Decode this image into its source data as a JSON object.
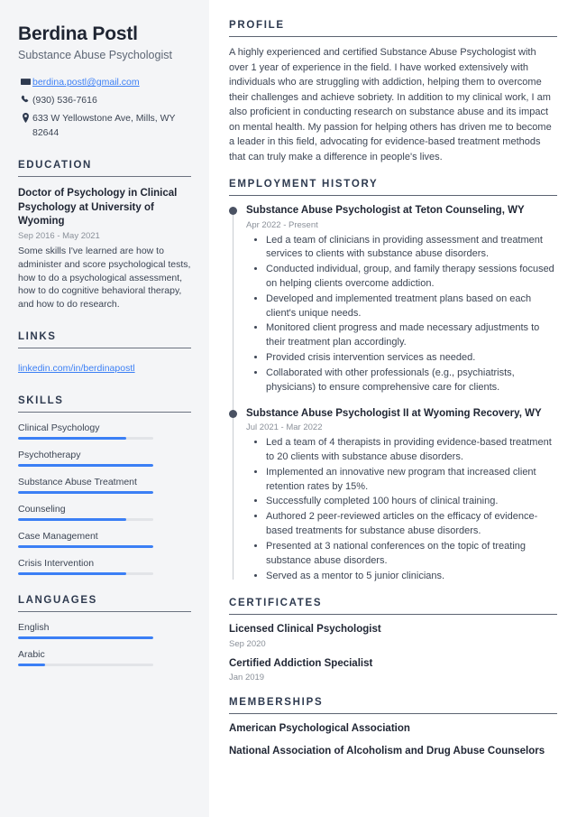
{
  "colors": {
    "accent": "#3b7ff5",
    "heading": "#2e3a4f",
    "sidebar_bg": "#f4f5f7",
    "muted": "#8a9099",
    "track": "#e2e4e8",
    "timeline_dot": "#4a5263"
  },
  "sidebar": {
    "name": "Berdina Postl",
    "job_title": "Substance Abuse Psychologist",
    "contact": [
      {
        "icon": "email-icon",
        "text": "berdina.postl@gmail.com",
        "is_link": true
      },
      {
        "icon": "phone-icon",
        "text": "(930) 536-7616",
        "is_link": false
      },
      {
        "icon": "location-icon",
        "text": "633 W Yellowstone Ave, Mills, WY 82644",
        "is_link": false
      }
    ],
    "education": {
      "heading": "EDUCATION",
      "items": [
        {
          "degree": "Doctor of Psychology in Clinical Psychology at University of Wyoming",
          "date": "Sep 2016 - May 2021",
          "description": "Some skills I've learned are how to administer and score psychological tests, how to do a psychological assessment, how to do cognitive behavioral therapy, and how to do research."
        }
      ]
    },
    "links": {
      "heading": "LINKS",
      "items": [
        {
          "label": "linkedin.com/in/berdinapostl"
        }
      ]
    },
    "skills": {
      "heading": "SKILLS",
      "items": [
        {
          "label": "Clinical Psychology",
          "level": 80
        },
        {
          "label": "Psychotherapy",
          "level": 100
        },
        {
          "label": "Substance Abuse Treatment",
          "level": 100
        },
        {
          "label": "Counseling",
          "level": 80
        },
        {
          "label": "Case Management",
          "level": 100
        },
        {
          "label": "Crisis Intervention",
          "level": 80
        }
      ]
    },
    "languages": {
      "heading": "LANGUAGES",
      "items": [
        {
          "label": "English",
          "level": 100
        },
        {
          "label": "Arabic",
          "level": 20
        }
      ]
    }
  },
  "main": {
    "profile": {
      "heading": "PROFILE",
      "text": "A highly experienced and certified Substance Abuse Psychologist with over 1 year of experience in the field. I have worked extensively with individuals who are struggling with addiction, helping them to overcome their challenges and achieve sobriety. In addition to my clinical work, I am also proficient in conducting research on substance abuse and its impact on mental health. My passion for helping others has driven me to become a leader in this field, advocating for evidence-based treatment methods that can truly make a difference in people's lives."
    },
    "employment": {
      "heading": "EMPLOYMENT HISTORY",
      "jobs": [
        {
          "title": "Substance Abuse Psychologist at Teton Counseling, WY",
          "date": "Apr 2022 - Present",
          "bullets": [
            "Led a team of clinicians in providing assessment and treatment services to clients with substance abuse disorders.",
            "Conducted individual, group, and family therapy sessions focused on helping clients overcome addiction.",
            "Developed and implemented treatment plans based on each client's unique needs.",
            "Monitored client progress and made necessary adjustments to their treatment plan accordingly.",
            "Provided crisis intervention services as needed.",
            "Collaborated with other professionals (e.g., psychiatrists, physicians) to ensure comprehensive care for clients."
          ]
        },
        {
          "title": "Substance Abuse Psychologist II at Wyoming Recovery, WY",
          "date": "Jul 2021 - Mar 2022",
          "bullets": [
            "Led a team of 4 therapists in providing evidence-based treatment to 20 clients with substance abuse disorders.",
            "Implemented an innovative new program that increased client retention rates by 15%.",
            "Successfully completed 100 hours of clinical training.",
            "Authored 2 peer-reviewed articles on the efficacy of evidence-based treatments for substance abuse disorders.",
            "Presented at 3 national conferences on the topic of treating substance abuse disorders.",
            "Served as a mentor to 5 junior clinicians."
          ]
        }
      ]
    },
    "certificates": {
      "heading": "CERTIFICATES",
      "items": [
        {
          "title": "Licensed Clinical Psychologist",
          "date": "Sep 2020"
        },
        {
          "title": "Certified Addiction Specialist",
          "date": "Jan 2019"
        }
      ]
    },
    "memberships": {
      "heading": "MEMBERSHIPS",
      "items": [
        {
          "title": "American Psychological Association"
        },
        {
          "title": "National Association of Alcoholism and Drug Abuse Counselors"
        }
      ]
    }
  }
}
